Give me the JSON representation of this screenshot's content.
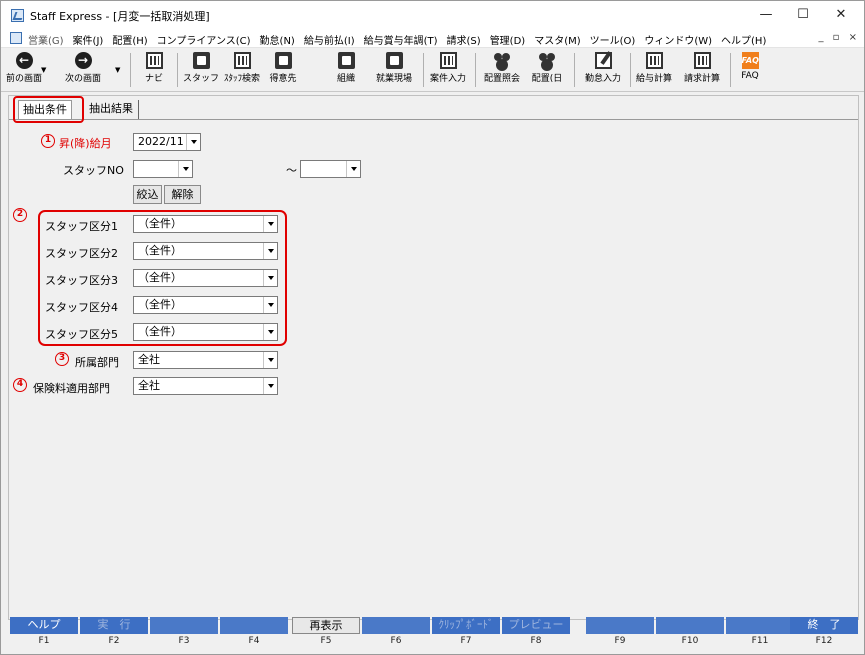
{
  "window": {
    "title": "Staff Express - [月変一括取消処理]",
    "controls": [
      "—",
      "☐",
      "✕"
    ]
  },
  "menu": {
    "items": [
      "営業(G)",
      "案件(J)",
      "配置(H)",
      "コンプライアンス(C)",
      "勤怠(N)",
      "給与前払(I)",
      "給与賞与年調(T)",
      "請求(S)",
      "管理(D)",
      "マスタ(M)",
      "ツール(O)",
      "ウィンドウ(W)",
      "ヘルプ(H)"
    ],
    "mdi_controls": "_ ▫ ×"
  },
  "toolbar": {
    "back_label": "前の画面",
    "forward_label": "次の画面",
    "nav_label": "ナビ",
    "staff_label": "スタッフ",
    "staff_search_label": "ｽﾀｯﾌ検索",
    "client_label": "得意先",
    "org_label": "組織",
    "site_label": "就業現場",
    "case_input_label": "案件入力",
    "placement_inquiry_label": "配置照会",
    "placement_day_label": "配置(日",
    "attendance_input_label": "勤怠入力",
    "payroll_calc_label": "給与計算",
    "billing_calc_label": "請求計算",
    "faq_label": "FAQ",
    "faq_icon_text": "FAQ"
  },
  "tabs": {
    "conditions": "抽出条件",
    "results": "抽出結果"
  },
  "form": {
    "num1": "1",
    "num2": "2",
    "num3": "3",
    "num4": "4",
    "month_label": "昇(降)給月",
    "month_value": "2022/11",
    "staff_no_label": "スタッフNO",
    "staff_no_from": "",
    "tilde": "～",
    "staff_no_to": "",
    "filter_button": "絞込",
    "clear_button": "解除",
    "staff_categories": [
      {
        "label": "スタッフ区分1",
        "value": "（全件）"
      },
      {
        "label": "スタッフ区分2",
        "value": "（全件）"
      },
      {
        "label": "スタッフ区分3",
        "value": "（全件）"
      },
      {
        "label": "スタッフ区分4",
        "value": "（全件）"
      },
      {
        "label": "スタッフ区分5",
        "value": "（全件）"
      }
    ],
    "dept_label": "所属部門",
    "dept_value": "全社",
    "insurance_dept_label": "保険料適用部門",
    "insurance_dept_value": "全社"
  },
  "fkeys": [
    {
      "label": "ヘルプ",
      "code": "F1"
    },
    {
      "label": "実　行",
      "code": "F2"
    },
    {
      "label": "",
      "code": "F3"
    },
    {
      "label": "",
      "code": "F4"
    },
    {
      "label": "再表示",
      "code": "F5"
    },
    {
      "label": "",
      "code": "F6"
    },
    {
      "label": "ｸﾘｯﾌﾟﾎﾞｰﾄﾞ",
      "code": "F7"
    },
    {
      "label": "プレビュー",
      "code": "F8"
    },
    {
      "label": "",
      "code": "F9"
    },
    {
      "label": "",
      "code": "F10"
    },
    {
      "label": "",
      "code": "F11"
    },
    {
      "label": "終　了",
      "code": "F12"
    }
  ],
  "colors": {
    "highlight_red": "#e00000",
    "fkey_blue": "#3d6fc4",
    "faq_orange": "#f07f1c"
  }
}
